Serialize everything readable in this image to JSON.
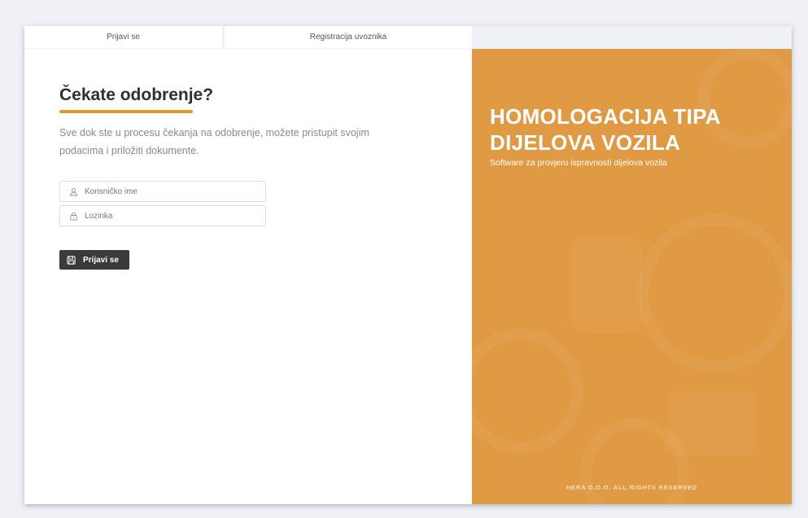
{
  "tabs": {
    "login_label": "Prijavi se",
    "register_label": "Registracija uvoznika"
  },
  "login": {
    "title": "Čekate odobrenje?",
    "description": "Sve dok ste u procesu čekanja na odobrenje, možete pristupit svojim podacima i priložiti dokumente.",
    "username_placeholder": "Korisničko ime",
    "password_placeholder": "Lozinka",
    "submit_label": "Prijavi se",
    "icons": {
      "username": "user-icon",
      "password": "lock-icon",
      "submit": "save-icon"
    }
  },
  "hero": {
    "title": "HOMOLOGACIJA TIPA DIJELOVA VOZILA",
    "subtitle": "Software za provjeru ispravnosti dijelova vozila",
    "footer": "HERA D.O.O. ALL RIGHTS RESERVED"
  },
  "colors": {
    "accent": "#e5962f",
    "hero_background": "#e09a43",
    "button": "#3a3a3a",
    "page_background": "#eef1f6"
  }
}
